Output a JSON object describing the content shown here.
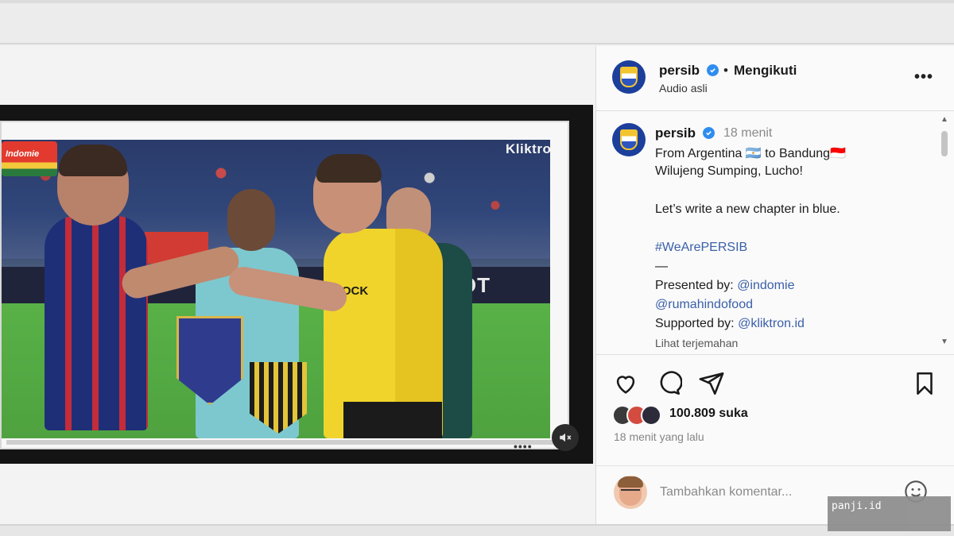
{
  "post": {
    "account": "persib",
    "follow_status": "Mengikuti",
    "separator": "•",
    "audio": "Audio asli",
    "more": "•••"
  },
  "caption": {
    "account": "persib",
    "time": "18 menit",
    "line1": "From Argentina 🇦🇷 to Bandung🇮🇩",
    "line2": "Wilujeng Sumping, Lucho!",
    "line3": "Let’s write a new chapter in blue.",
    "hashtag": "#WeArePERSIB",
    "dash": "—",
    "presented_label": "Presented by:",
    "presented_mention1": "@indomie",
    "presented_mention2": "@rumahindofood",
    "supported_label": "Supported by:",
    "supported_mention": "@kliktron.id",
    "see_translation": "Lihat terjemahan"
  },
  "engagement": {
    "likes": "100.809 suka",
    "time_ago": "18 menit yang lalu"
  },
  "comment": {
    "placeholder": "Tambahkan komentar..."
  },
  "media": {
    "sponsor_badge": "Indomie",
    "sponsor_watermark": "Kliktron",
    "board_text_left": "OT",
    "board_text_right": "LOT",
    "dots": "••••",
    "shirt_text": "ROCK"
  },
  "watermark": {
    "text": "panji.id"
  },
  "colors": {
    "verified": "#2f8df0",
    "link": "#3a5fa8",
    "persib_blue": "#1c3f9c"
  },
  "icons": [
    "verified-badge-icon",
    "more-options-icon",
    "heart-icon",
    "comment-icon",
    "share-icon",
    "bookmark-icon",
    "mute-icon",
    "emoji-icon",
    "scroll-up-icon",
    "scroll-down-icon"
  ]
}
